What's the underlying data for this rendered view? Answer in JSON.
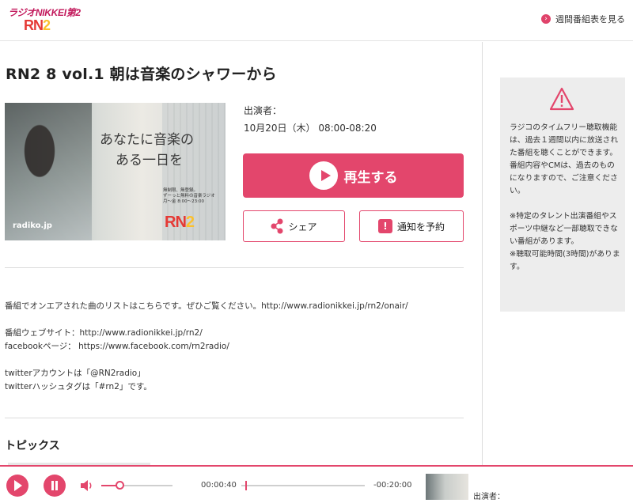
{
  "header": {
    "logo_line1": "ラジオNIKKEI第2",
    "logo_r": "RN",
    "logo_n": "2",
    "weekly_schedule": "週間番組表を見る"
  },
  "program": {
    "title": "RN2 8 vol.1 朝は音楽のシャワーから",
    "thumbnail": {
      "line1": "あなたに音楽の",
      "line2": "ある一日を",
      "subtitle1": "無制限、無登録。",
      "subtitle2": "ずーっと無料の音楽ラジオ",
      "subtitle3": "月～金 8:00～23:00",
      "brand_r": "RN",
      "brand_2": "2",
      "radiko": "radiko.jp"
    },
    "performer_label": "出演者：",
    "datetime": "10月20日（木） 08:00-08:20",
    "play_label": "再生する",
    "share_label": "シェア",
    "notify_label": "通知を予約"
  },
  "description": {
    "line1": "番組でオンエアされた曲のリストはこちらです。ぜひご覧ください。http://www.radionikkei.jp/rn2/onair/",
    "line2": "番組ウェブサイト：http://www.radionikkei.jp/rn2/",
    "line3": "facebookページ： https://www.facebook.com/rn2radio/",
    "line4": "twitterアカウントは「@RN2radio」",
    "line5": "twitterハッシュタグは「#rn2」です。"
  },
  "topics_heading": "トピックス",
  "notice": {
    "icon": "warning-icon",
    "text": "ラジコのタイムフリー聴取機能は、過去１週間以内に放送された番組を聴くことができます。\n番組内容やCMは、過去のものになりますので、ご注意ください。\n\n※特定のタレント出演番組やスポーツ中継など一部聴取できない番組があります。\n※聴取可能時間(3時間)があります。"
  },
  "player": {
    "current_time": "00:00:40",
    "remaining_time": "-00:20:00",
    "performer_label": "出演者：",
    "volume_level": 0.25,
    "progress": 0.033
  },
  "colors": {
    "accent": "#e3466c",
    "brand_red": "#e53935",
    "brand_yellow": "#fbc02d",
    "notice_bg": "#ededed"
  }
}
